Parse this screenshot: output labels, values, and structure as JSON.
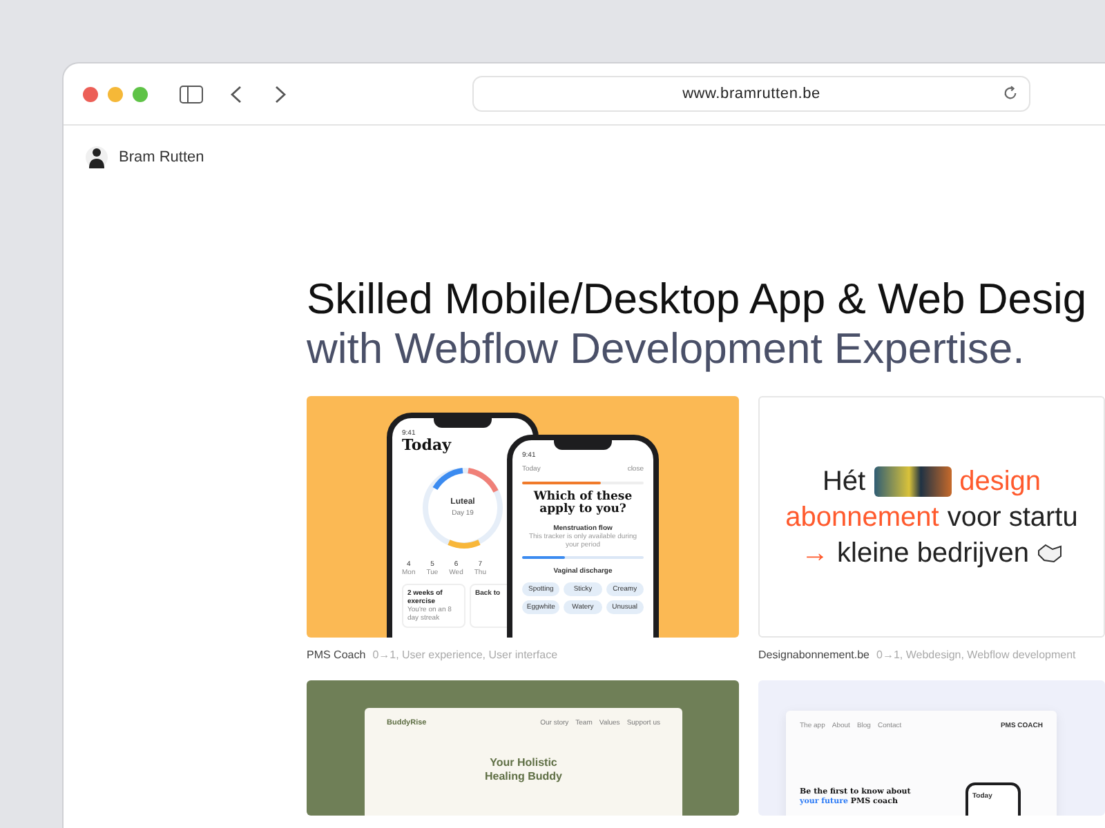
{
  "browser": {
    "url": "www.bramrutten.be"
  },
  "header": {
    "name": "Bram Rutten"
  },
  "hero": {
    "line_1": "Skilled Mobile/Desktop App & Web Desig",
    "line_2": "with Webflow Development Expertise."
  },
  "projects": [
    {
      "kind": "pms-app",
      "title": "PMS Coach",
      "tags": "0→1, User experience, User interface",
      "thumbnail": {
        "time_1": "9:41",
        "today": "Today",
        "phase": "Luteal",
        "day": "Day 19",
        "days": [
          "4",
          "5",
          "6",
          "7"
        ],
        "weekdays": [
          "Mon",
          "Tue",
          "Wed",
          "Thu"
        ],
        "exercise": "2 weeks of exercise",
        "exercise_note": "You're on an 8 day streak",
        "back_card": "Back to",
        "time_2": "9:41",
        "back": "Today",
        "close": "close",
        "progress": {
          "level": 0.65
        },
        "question": "Which of these apply to you?",
        "flow_title": "Menstruation flow",
        "flow_note": "This tracker is only available during your period",
        "slider": {
          "level": 0.35
        },
        "discharge_title": "Vaginal discharge",
        "chips": [
          {
            "label": "Spotting"
          },
          {
            "label": "Sticky"
          },
          {
            "label": "Creamy"
          },
          {
            "label": "Eggwhite"
          },
          {
            "label": "Watery"
          },
          {
            "label": "Unusual"
          }
        ]
      }
    },
    {
      "kind": "headline",
      "title": "Designabonnement.be",
      "tags": "0→1, Webdesign, Webflow development",
      "thumbnail": {
        "lines": [
          [
            {
              "kind": "text",
              "text": "Hét",
              "accent": false
            },
            {
              "kind": "image"
            },
            {
              "kind": "text",
              "text": "design",
              "accent": true
            }
          ],
          [
            {
              "kind": "text",
              "text": "abonnement",
              "accent": true
            },
            {
              "kind": "text",
              "text": "voor startu",
              "accent": false
            }
          ],
          [
            {
              "kind": "text",
              "text": "→",
              "accent": true
            },
            {
              "kind": "text",
              "text": "kleine bedrijven",
              "accent": false
            },
            {
              "kind": "icon"
            }
          ]
        ]
      }
    },
    {
      "kind": "landing-green",
      "thumbnail": {
        "logo": "BuddyRise",
        "nav": [
          "Our story",
          "Team",
          "Values",
          "Support us"
        ],
        "heading_1": "Your Holistic",
        "heading_2": "Healing Buddy"
      }
    },
    {
      "kind": "landing-light",
      "thumbnail": {
        "nav": [
          "The app",
          "About",
          "Blog",
          "Contact"
        ],
        "logo": "PMS COACH",
        "heading_1": "Be the first to know about",
        "heading_accent": "your future",
        "heading_rest": "PMS coach",
        "phone_title": "Today"
      }
    }
  ]
}
